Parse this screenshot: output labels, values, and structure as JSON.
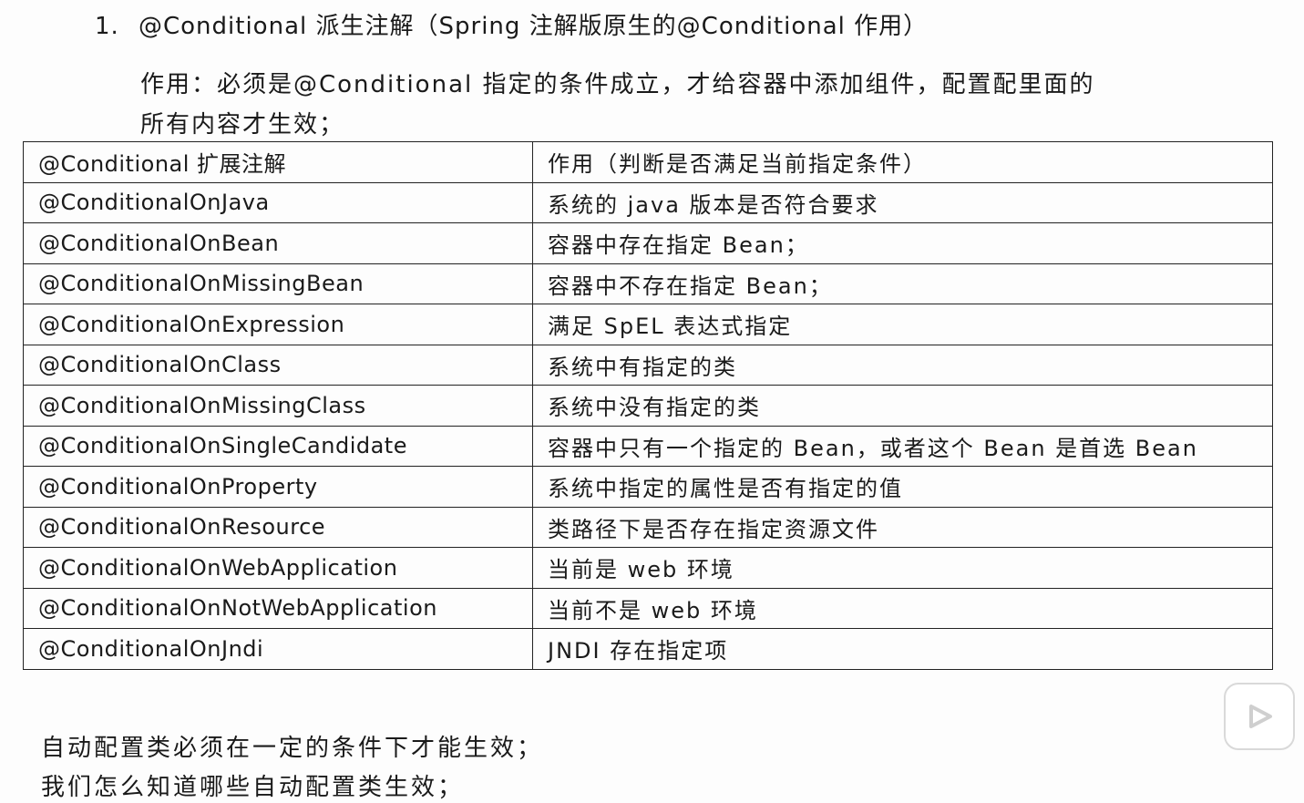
{
  "heading": {
    "number": "1.",
    "text": "@Conditional 派生注解（Spring 注解版原生的@Conditional 作用）"
  },
  "description": {
    "line1": "作用：必须是@Conditional 指定的条件成立，才给容器中添加组件，配置配里面的",
    "line2": "所有内容才生效；"
  },
  "table": {
    "header": {
      "col1": "@Conditional 扩展注解",
      "col2": "作用（判断是否满足当前指定条件）"
    },
    "rows": [
      {
        "annotation": "@ConditionalOnJava",
        "effect": "系统的 java 版本是否符合要求"
      },
      {
        "annotation": "@ConditionalOnBean",
        "effect": "容器中存在指定 Bean；"
      },
      {
        "annotation": "@ConditionalOnMissingBean",
        "effect": "容器中不存在指定 Bean；"
      },
      {
        "annotation": "@ConditionalOnExpression",
        "effect": "满足 SpEL 表达式指定"
      },
      {
        "annotation": "@ConditionalOnClass",
        "effect": "系统中有指定的类"
      },
      {
        "annotation": "@ConditionalOnMissingClass",
        "effect": "系统中没有指定的类"
      },
      {
        "annotation": "@ConditionalOnSingleCandidate",
        "effect": "容器中只有一个指定的 Bean，或者这个 Bean 是首选 Bean"
      },
      {
        "annotation": "@ConditionalOnProperty",
        "effect": "系统中指定的属性是否有指定的值"
      },
      {
        "annotation": "@ConditionalOnResource",
        "effect": "类路径下是否存在指定资源文件"
      },
      {
        "annotation": "@ConditionalOnWebApplication",
        "effect": "当前是 web 环境"
      },
      {
        "annotation": "@ConditionalOnNotWebApplication",
        "effect": "当前不是 web 环境"
      },
      {
        "annotation": "@ConditionalOnJndi",
        "effect": "JNDI 存在指定项"
      }
    ]
  },
  "footer": {
    "line1": "自动配置类必须在一定的条件下才能生效；",
    "line2": "我们怎么知道哪些自动配置类生效；"
  },
  "overlay": {
    "icon": "play-icon",
    "colors": {
      "border": "#d9d9d9",
      "glyph": "#d0d0d0"
    }
  }
}
